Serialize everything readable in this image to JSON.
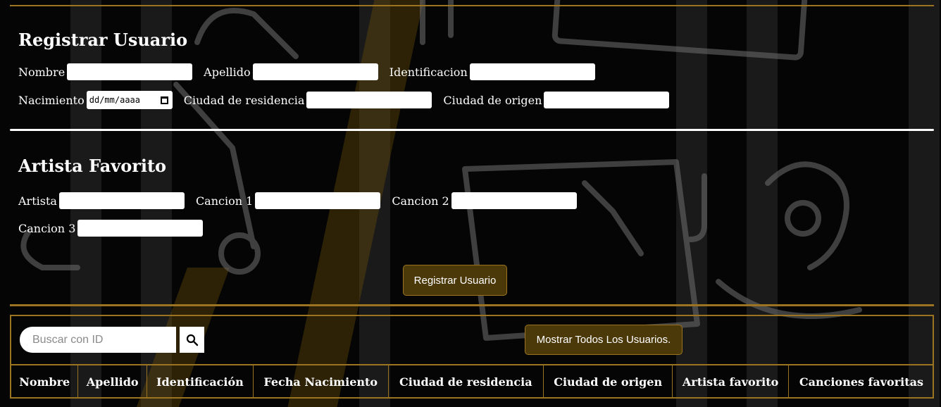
{
  "register": {
    "title": "Registrar Usuario",
    "fields": {
      "nombre": "Nombre",
      "apellido": "Apellido",
      "identificacion": "Identificacion",
      "nacimiento": "Nacimiento",
      "nacimiento_placeholder": "dd/mm/aaaa",
      "ciudad_residencia": "Ciudad de residencia",
      "ciudad_origen": "Ciudad de origen"
    }
  },
  "favorite": {
    "title": "Artista Favorito",
    "fields": {
      "artista": "Artista",
      "cancion1": "Cancion 1",
      "cancion2": "Cancion 2",
      "cancion3": "Cancion 3"
    }
  },
  "actions": {
    "register_button": "Registrar Usuario",
    "show_all_button": "Mostrar Todos Los Usuarios."
  },
  "search": {
    "placeholder": "Buscar con ID",
    "icon": "search-icon"
  },
  "table": {
    "columns": [
      "Nombre",
      "Apellido",
      "Identificación",
      "Fecha Nacimiento",
      "Ciudad de residencia",
      "Ciudad de origen",
      "Artista favorito",
      "Canciones favoritas"
    ]
  },
  "colors": {
    "background": "#050505",
    "accent_gold": "#9a7420",
    "button_fill": "#4c390a",
    "text": "#ffffff"
  }
}
